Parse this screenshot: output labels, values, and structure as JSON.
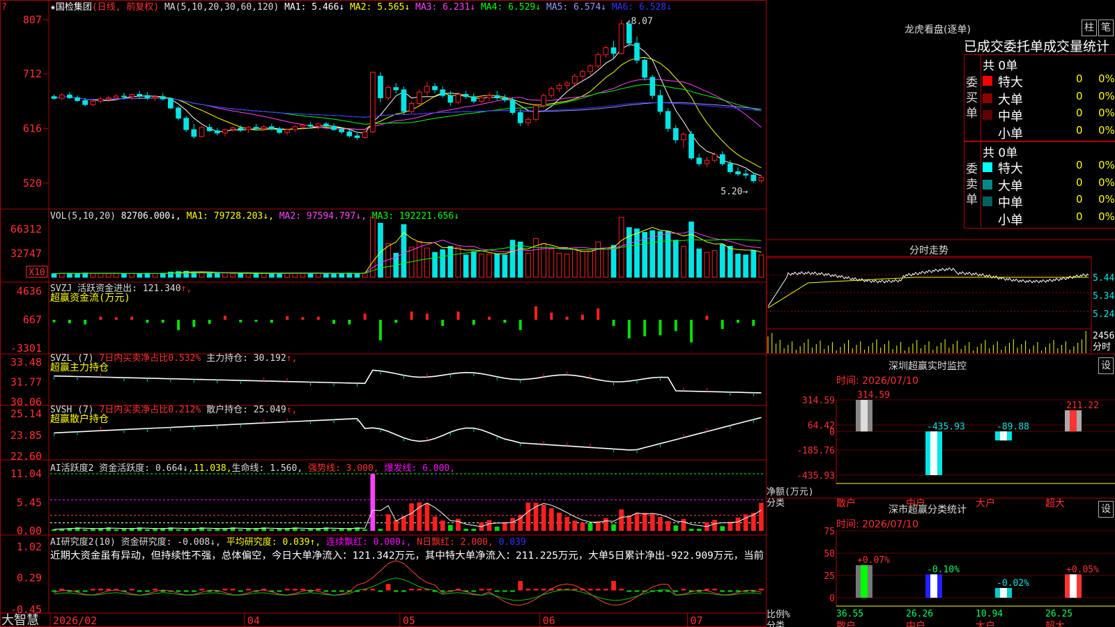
{
  "app": {
    "brand": "大智慧",
    "brand_marker": "?"
  },
  "colors": {
    "up": "#ff2020",
    "down": "#00e5e5",
    "grid": "#b00000",
    "ma1": "#ffffff",
    "ma2": "#ffff00",
    "ma3": "#ff40ff",
    "ma4": "#00ff00",
    "ma5": "#9999ff",
    "ma6": "#3333ff"
  },
  "header": {
    "stock": "★国检集团",
    "mode": "(日线, 前复权)",
    "ma_label": "MA(5,10,20,30,60,120)",
    "ma": [
      {
        "name": "MA1:",
        "value": "5.466",
        "arrow": "↓"
      },
      {
        "name": "MA2:",
        "value": "5.565",
        "arrow": "↓"
      },
      {
        "name": "MA3:",
        "value": "6.231",
        "arrow": "↓"
      },
      {
        "name": "MA4:",
        "value": "6.529",
        "arrow": "↓"
      },
      {
        "name": "MA5:",
        "value": "6.574",
        "arrow": "↓"
      },
      {
        "name": "MA6:",
        "value": "6.528",
        "arrow": "↓"
      }
    ]
  },
  "price_labels": {
    "high": "8.07",
    "low": "5.20"
  },
  "chart_data": [
    {
      "type": "candlestick",
      "name": "price",
      "ylim": [
        5.0,
        8.2
      ],
      "yticks": [
        "807",
        "712",
        "616",
        "520"
      ],
      "ytick_values": [
        8.07,
        7.12,
        6.16,
        5.2
      ],
      "candles": [
        [
          6.72,
          6.76,
          6.67,
          6.69
        ],
        [
          6.69,
          6.78,
          6.66,
          6.75
        ],
        [
          6.75,
          6.8,
          6.68,
          6.7
        ],
        [
          6.7,
          6.74,
          6.63,
          6.65
        ],
        [
          6.65,
          6.7,
          6.55,
          6.58
        ],
        [
          6.58,
          6.66,
          6.55,
          6.64
        ],
        [
          6.64,
          6.72,
          6.6,
          6.68
        ],
        [
          6.68,
          6.74,
          6.63,
          6.7
        ],
        [
          6.7,
          6.76,
          6.66,
          6.73
        ],
        [
          6.73,
          6.79,
          6.68,
          6.72
        ],
        [
          6.72,
          6.77,
          6.66,
          6.76
        ],
        [
          6.76,
          6.82,
          6.7,
          6.74
        ],
        [
          6.74,
          6.8,
          6.66,
          6.7
        ],
        [
          6.7,
          6.75,
          6.64,
          6.72
        ],
        [
          6.72,
          6.78,
          6.65,
          6.68
        ],
        [
          6.68,
          6.7,
          6.5,
          6.52
        ],
        [
          6.52,
          6.55,
          6.3,
          6.34
        ],
        [
          6.34,
          6.38,
          6.1,
          6.14
        ],
        [
          6.14,
          6.24,
          5.98,
          6.02
        ],
        [
          6.02,
          6.2,
          6.0,
          6.18
        ],
        [
          6.18,
          6.24,
          6.1,
          6.12
        ],
        [
          6.12,
          6.17,
          6.04,
          6.08
        ],
        [
          6.08,
          6.16,
          6.02,
          6.14
        ],
        [
          6.14,
          6.2,
          6.1,
          6.17
        ],
        [
          6.17,
          6.22,
          6.1,
          6.14
        ],
        [
          6.14,
          6.2,
          6.08,
          6.18
        ],
        [
          6.18,
          6.24,
          6.12,
          6.16
        ],
        [
          6.16,
          6.22,
          6.12,
          6.19
        ],
        [
          6.19,
          6.24,
          6.12,
          6.15
        ],
        [
          6.15,
          6.19,
          6.06,
          6.09
        ],
        [
          6.09,
          6.16,
          6.04,
          6.14
        ],
        [
          6.14,
          6.22,
          6.1,
          6.19
        ],
        [
          6.19,
          6.24,
          6.14,
          6.22
        ],
        [
          6.22,
          6.27,
          6.16,
          6.2
        ],
        [
          6.2,
          6.26,
          6.14,
          6.24
        ],
        [
          6.24,
          6.28,
          6.18,
          6.2
        ],
        [
          6.2,
          6.25,
          6.12,
          6.14
        ],
        [
          6.14,
          6.18,
          6.06,
          6.1
        ],
        [
          6.1,
          6.14,
          6.0,
          6.03
        ],
        [
          6.03,
          6.08,
          5.96,
          6.0
        ],
        [
          6.0,
          6.12,
          5.98,
          6.1
        ],
        [
          6.1,
          6.98,
          6.08,
          7.15
        ],
        [
          7.08,
          7.15,
          6.62,
          6.7
        ],
        [
          6.7,
          6.92,
          6.66,
          6.88
        ],
        [
          6.88,
          6.96,
          6.78,
          6.84
        ],
        [
          6.84,
          6.9,
          6.4,
          6.46
        ],
        [
          6.46,
          6.64,
          6.42,
          6.6
        ],
        [
          6.6,
          6.85,
          6.56,
          6.8
        ],
        [
          6.8,
          6.98,
          6.74,
          6.9
        ],
        [
          6.9,
          6.96,
          6.78,
          6.84
        ],
        [
          6.84,
          6.9,
          6.7,
          6.74
        ],
        [
          6.74,
          6.82,
          6.56,
          6.62
        ],
        [
          6.62,
          6.8,
          6.58,
          6.76
        ],
        [
          6.76,
          6.82,
          6.68,
          6.72
        ],
        [
          6.72,
          6.78,
          6.6,
          6.64
        ],
        [
          6.64,
          6.74,
          6.6,
          6.7
        ],
        [
          6.7,
          6.8,
          6.64,
          6.74
        ],
        [
          6.74,
          6.82,
          6.66,
          6.7
        ],
        [
          6.7,
          6.76,
          6.62,
          6.66
        ],
        [
          6.66,
          6.7,
          6.4,
          6.44
        ],
        [
          6.44,
          6.5,
          6.2,
          6.26
        ],
        [
          6.26,
          6.36,
          6.2,
          6.32
        ],
        [
          6.32,
          6.6,
          6.28,
          6.56
        ],
        [
          6.56,
          6.78,
          6.52,
          6.74
        ],
        [
          6.74,
          6.9,
          6.7,
          6.86
        ],
        [
          6.86,
          6.96,
          6.8,
          6.92
        ],
        [
          6.92,
          7.0,
          6.84,
          6.96
        ],
        [
          6.96,
          7.12,
          6.92,
          7.08
        ],
        [
          7.08,
          7.2,
          7.02,
          7.16
        ],
        [
          7.16,
          7.3,
          7.1,
          7.26
        ],
        [
          7.26,
          7.5,
          7.22,
          7.46
        ],
        [
          7.46,
          7.62,
          7.4,
          7.58
        ],
        [
          7.58,
          7.7,
          7.4,
          7.48
        ],
        [
          7.48,
          8.07,
          7.46,
          8.0
        ],
        [
          8.0,
          8.07,
          7.6,
          7.66
        ],
        [
          7.66,
          7.78,
          7.3,
          7.36
        ],
        [
          7.36,
          7.4,
          7.0,
          7.06
        ],
        [
          7.06,
          7.1,
          6.68,
          6.74
        ],
        [
          6.74,
          6.84,
          6.4,
          6.46
        ],
        [
          6.46,
          6.52,
          6.1,
          6.16
        ],
        [
          6.16,
          6.22,
          5.9,
          5.96
        ],
        [
          5.96,
          6.1,
          5.82,
          6.06
        ],
        [
          6.06,
          6.12,
          5.6,
          5.64
        ],
        [
          5.64,
          5.72,
          5.5,
          5.54
        ],
        [
          5.54,
          5.66,
          5.48,
          5.6
        ],
        [
          5.6,
          5.74,
          5.56,
          5.7
        ],
        [
          5.7,
          5.76,
          5.5,
          5.54
        ],
        [
          5.54,
          5.6,
          5.36,
          5.4
        ],
        [
          5.4,
          5.48,
          5.32,
          5.36
        ],
        [
          5.36,
          5.44,
          5.28,
          5.34
        ],
        [
          5.34,
          5.38,
          5.2,
          5.24
        ],
        [
          5.24,
          5.32,
          5.2,
          5.3
        ]
      ]
    },
    {
      "type": "bar",
      "name": "volume",
      "title": "VOL(5,10,20)",
      "yticks": [
        "66312",
        "32747"
      ],
      "ytick_values": [
        66312,
        32747
      ],
      "unit": "X10",
      "ylim": [
        0,
        82706
      ],
      "legend": [
        {
          "name": "MA1:",
          "value": "79728.203",
          "arrow": "↓"
        },
        {
          "name": "MA2:",
          "value": "97594.797",
          "arrow": "↓"
        },
        {
          "name": "MA3:",
          "value": "192221.656",
          "arrow": "↓"
        }
      ],
      "current": "82706.000"
    },
    {
      "type": "bar",
      "name": "svzj",
      "title": "SVZJ",
      "label": "活跃资金进出: 121.340",
      "arrow": "↑",
      "subtitle": "超赢资金流(万元)",
      "yticks": [
        "4636",
        "667",
        "-3301"
      ],
      "ytick_values": [
        4636,
        667,
        -3301
      ]
    },
    {
      "type": "line",
      "name": "svzl",
      "title": "SVZL (7)",
      "ratio": "7日内买卖净占比0.532%",
      "label": "主力持仓: 30.192",
      "arrow": "↑",
      "subtitle": "超赢主力持仓",
      "yticks": [
        "33.48",
        "31.77",
        "30.06"
      ],
      "ytick_values": [
        33.48,
        31.77,
        30.06
      ]
    },
    {
      "type": "line",
      "name": "svsh",
      "title": "SVSH (7)",
      "ratio": "7日内买卖净占比0.212%",
      "label": "散户持仓: 25.049",
      "arrow": "↑",
      "subtitle": "超赢散户持仓",
      "yticks": [
        "25.14",
        "23.85",
        "22.60"
      ],
      "ytick_values": [
        25.14,
        23.85,
        22.6
      ]
    },
    {
      "type": "bar",
      "name": "ai_active",
      "title": "AI活跃度2",
      "legend": [
        {
          "name": "资金活跃度:",
          "value": "0.664",
          "arrow": "↓"
        },
        {
          "name": "",
          "value": "11.038",
          "arrow": ""
        },
        {
          "name": "生命线:",
          "value": "1.560",
          "arrow": ""
        },
        {
          "name": "强势线:",
          "value": "3.000",
          "arrow": ""
        },
        {
          "name": "爆发线:",
          "value": "6.000",
          "arrow": ""
        }
      ],
      "yticks": [
        "11.04",
        "5.45",
        "0.00"
      ],
      "ytick_values": [
        11.04,
        5.45,
        0.0
      ]
    },
    {
      "type": "bar",
      "name": "ai_research",
      "title": "AI研究度2(10)",
      "legend": [
        {
          "name": "资金研究度:",
          "value": "-0.008",
          "arrow": "↓"
        },
        {
          "name": "平均研究度:",
          "value": "0.039",
          "arrow": "↑"
        },
        {
          "name": "连续飘红:",
          "value": "0.000",
          "arrow": "↓"
        },
        {
          "name": "N日飘红:",
          "value": "2.000",
          "arrow": ""
        },
        {
          "name": "",
          "value": "0.039",
          "arrow": ""
        }
      ],
      "comment": "近期大资金虽有异动，但持续性不强，总体偏空，今日大单净流入：121.342万元，其中特大单净流入：211.225万元，大单5日累计净出-922.909万元，当前",
      "yticks": [
        "1.02",
        "0.29",
        "-0.45"
      ],
      "ytick_values": [
        1.02,
        0.29,
        -0.45
      ]
    },
    {
      "type": "line",
      "name": "intraday",
      "title": "分时走势",
      "yticks": [
        "5.44",
        "5.34",
        "5.24"
      ],
      "volume_ticks": [
        "2456",
        "分时"
      ]
    },
    {
      "type": "bar",
      "name": "shenzhen_monitor",
      "title": "深圳超赢实时监控",
      "date_label": "时间: 2026/07/10",
      "yticks": [
        "314.59",
        "64.42",
        "0",
        "-185.76",
        "-435.93"
      ],
      "ytick_values": [
        314.59,
        64.42,
        0,
        -185.76,
        -435.93
      ],
      "categories": [
        "散户",
        "中户",
        "大户",
        "超大"
      ],
      "values": [
        314.59,
        -435.93,
        -89.88,
        211.22
      ],
      "value_labels": [
        "314.59",
        "-435.93",
        "-89.88",
        "211.22"
      ],
      "ylabel": "净额(万元)",
      "xlabel": "分类"
    },
    {
      "type": "bar",
      "name": "shenzhen_class",
      "title": "深市超赢分类统计",
      "date_label": "时间: 2026/07/10",
      "yticks": [
        "75",
        "50",
        "25",
        "0"
      ],
      "ytick_values": [
        75,
        50,
        25,
        0
      ],
      "categories": [
        "散户",
        "中户",
        "大户",
        "超大"
      ],
      "values": [
        36.55,
        26.26,
        10.94,
        26.25
      ],
      "value_labels": [
        "36.55",
        "26.26",
        "10.94",
        "26.25"
      ],
      "change_labels": [
        "+0.07%",
        "-0.10%",
        "-0.02%",
        "+0.05%"
      ],
      "ylabel": "比例%",
      "xlabel": "分类"
    }
  ],
  "x_axis": {
    "labels": [
      "2026/02",
      "04",
      "05",
      "06",
      "07"
    ],
    "label_bars": [
      0,
      25,
      45,
      63,
      82
    ]
  },
  "dragon": {
    "title": "龙虎看盘(逐单)",
    "btn_bar": "柱",
    "btn_trade": "笔",
    "table_title": "已成交委托单成交量统计",
    "buy_label": "委买单",
    "sell_label": "委卖单",
    "buy_total": "共 0单",
    "sell_total": "共 0单",
    "buy_rows": [
      {
        "name": "特大",
        "count": "0",
        "pct": "0%",
        "color": "#ff0000"
      },
      {
        "name": "大单",
        "count": "0",
        "pct": "0%",
        "color": "#8b0000"
      },
      {
        "name": "中单",
        "count": "0",
        "pct": "0%",
        "color": "#600000"
      },
      {
        "name": "小单",
        "count": "0",
        "pct": "0%",
        "color": "#000000"
      }
    ],
    "sell_rows": [
      {
        "name": "特大",
        "count": "0",
        "pct": "0%",
        "color": "#00ffff"
      },
      {
        "name": "大单",
        "count": "0",
        "pct": "0%",
        "color": "#008b8b"
      },
      {
        "name": "中单",
        "count": "0",
        "pct": "0%",
        "color": "#006060"
      },
      {
        "name": "小单",
        "count": "0",
        "pct": "0%",
        "color": "#000000"
      }
    ]
  },
  "settings_label": "设"
}
